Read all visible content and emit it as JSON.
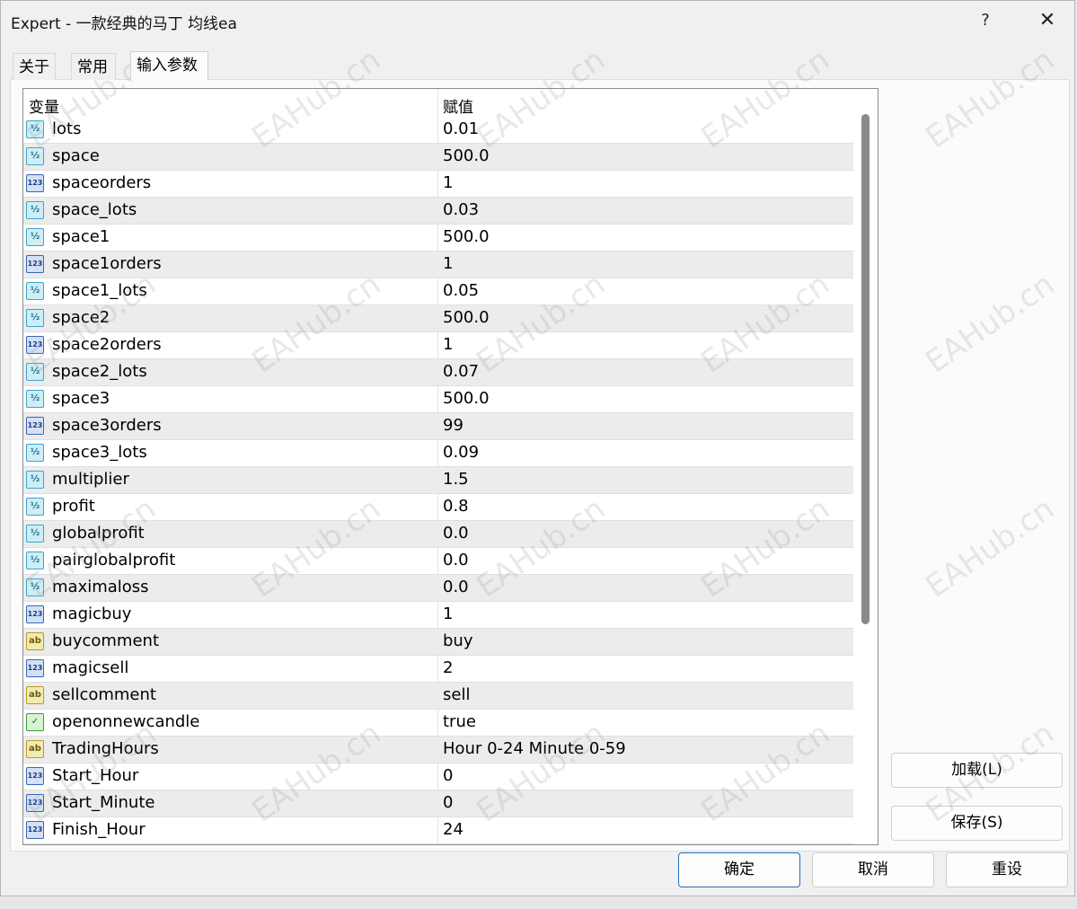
{
  "window": {
    "title": "Expert - 一款经典的马丁 均线ea",
    "help_label": "?",
    "close_label": "✕"
  },
  "tabs": [
    {
      "label": "关于",
      "active": false
    },
    {
      "label": "常用",
      "active": false
    },
    {
      "label": "输入参数",
      "active": true
    }
  ],
  "grid": {
    "headers": {
      "variable": "变量",
      "value": "赋值"
    },
    "rows": [
      {
        "name": "lots",
        "value": "0.01",
        "type": "double",
        "icon": "½"
      },
      {
        "name": "space",
        "value": "500.0",
        "type": "double",
        "icon": "½"
      },
      {
        "name": "spaceorders",
        "value": "1",
        "type": "int",
        "icon": "123"
      },
      {
        "name": "space_lots",
        "value": "0.03",
        "type": "double",
        "icon": "½"
      },
      {
        "name": "space1",
        "value": "500.0",
        "type": "double",
        "icon": "½"
      },
      {
        "name": "space1orders",
        "value": "1",
        "type": "int",
        "icon": "123"
      },
      {
        "name": "space1_lots",
        "value": "0.05",
        "type": "double",
        "icon": "½"
      },
      {
        "name": "space2",
        "value": "500.0",
        "type": "double",
        "icon": "½"
      },
      {
        "name": "space2orders",
        "value": "1",
        "type": "int",
        "icon": "123"
      },
      {
        "name": "space2_lots",
        "value": "0.07",
        "type": "double",
        "icon": "½"
      },
      {
        "name": "space3",
        "value": "500.0",
        "type": "double",
        "icon": "½"
      },
      {
        "name": "space3orders",
        "value": "99",
        "type": "int",
        "icon": "123"
      },
      {
        "name": "space3_lots",
        "value": "0.09",
        "type": "double",
        "icon": "½"
      },
      {
        "name": "multiplier",
        "value": "1.5",
        "type": "double",
        "icon": "½"
      },
      {
        "name": "profit",
        "value": "0.8",
        "type": "double",
        "icon": "½"
      },
      {
        "name": "globalprofit",
        "value": "0.0",
        "type": "double",
        "icon": "½"
      },
      {
        "name": "pairglobalprofit",
        "value": "0.0",
        "type": "double",
        "icon": "½"
      },
      {
        "name": "maximaloss",
        "value": "0.0",
        "type": "double",
        "icon": "½"
      },
      {
        "name": "magicbuy",
        "value": "1",
        "type": "int",
        "icon": "123"
      },
      {
        "name": "buycomment",
        "value": "buy",
        "type": "string",
        "icon": "ab"
      },
      {
        "name": "magicsell",
        "value": "2",
        "type": "int",
        "icon": "123"
      },
      {
        "name": "sellcomment",
        "value": "sell",
        "type": "string",
        "icon": "ab"
      },
      {
        "name": "openonnewcandle",
        "value": "true",
        "type": "bool",
        "icon": "✓"
      },
      {
        "name": "TradingHours",
        "value": "Hour 0-24 Minute 0-59",
        "type": "string",
        "icon": "ab"
      },
      {
        "name": "Start_Hour",
        "value": "0",
        "type": "int",
        "icon": "123"
      },
      {
        "name": "Start_Minute",
        "value": "0",
        "type": "int",
        "icon": "123"
      },
      {
        "name": "Finish_Hour",
        "value": "24",
        "type": "int",
        "icon": "123"
      }
    ]
  },
  "side_buttons": {
    "load": "加载(L)",
    "save": "保存(S)"
  },
  "footer_buttons": {
    "ok": "确定",
    "cancel": "取消",
    "reset": "重设"
  },
  "watermark_text": "EAHub.cn",
  "colors": {
    "primary_border": "#1f6ec2",
    "row_alt": "#ececec",
    "double_icon": "#3aa6c9",
    "int_icon": "#3b66b4",
    "string_icon": "#b69c2a",
    "bool_icon": "#3d9a3d"
  }
}
